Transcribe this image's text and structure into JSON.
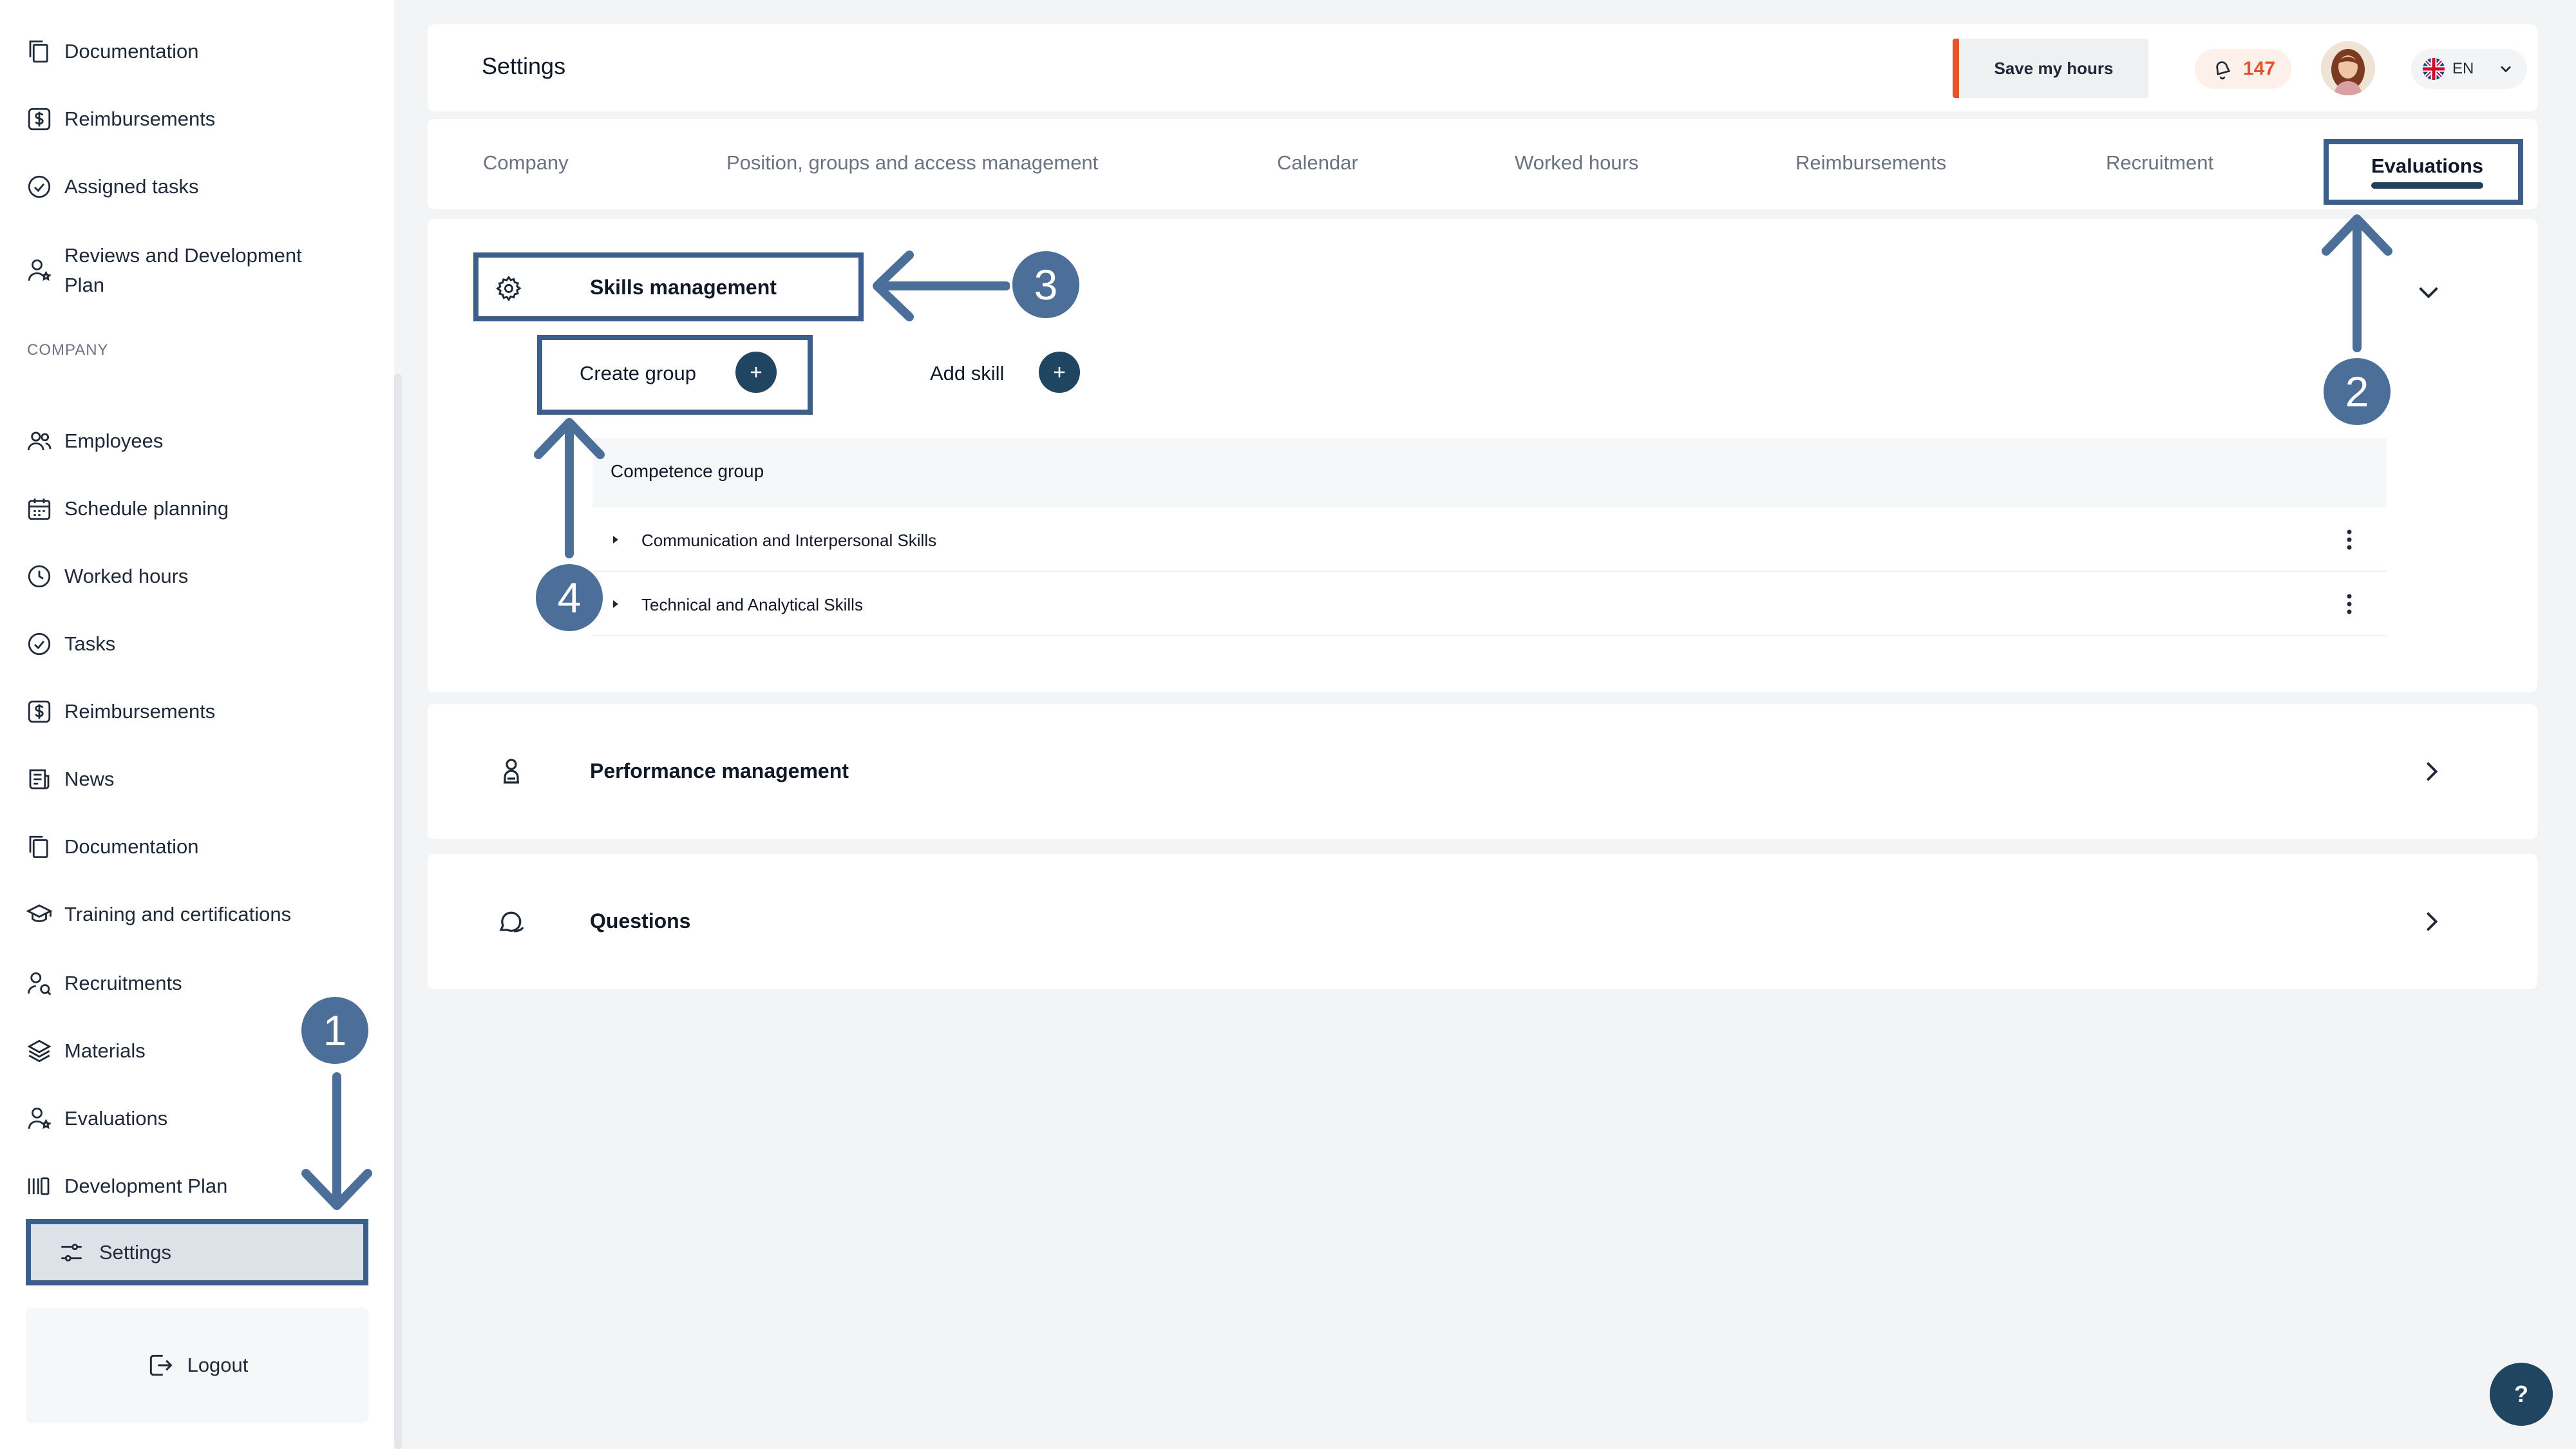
{
  "sidebar": {
    "items_top": [
      {
        "label": "Documentation",
        "icon": "documents-icon"
      },
      {
        "label": "Reimbursements",
        "icon": "dollar-icon"
      },
      {
        "label": "Assigned tasks",
        "icon": "check-circle-icon"
      },
      {
        "label": "Reviews and Development Plan",
        "icon": "user-star-icon"
      }
    ],
    "section_title": "COMPANY",
    "items_company": [
      {
        "label": "Employees",
        "icon": "users-icon"
      },
      {
        "label": "Schedule planning",
        "icon": "calendar-icon"
      },
      {
        "label": "Worked hours",
        "icon": "clock-icon"
      },
      {
        "label": "Tasks",
        "icon": "check-circle-icon"
      },
      {
        "label": "Reimbursements",
        "icon": "dollar-icon"
      },
      {
        "label": "News",
        "icon": "news-icon"
      },
      {
        "label": "Documentation",
        "icon": "documents-icon"
      },
      {
        "label": "Training and certifications",
        "icon": "graduation-cap-icon"
      },
      {
        "label": "Recruitments",
        "icon": "user-search-icon"
      },
      {
        "label": "Materials",
        "icon": "layers-icon"
      },
      {
        "label": "Evaluations",
        "icon": "user-star-icon"
      },
      {
        "label": "Development Plan",
        "icon": "chart-bars-icon"
      }
    ],
    "settings": "Settings",
    "logout": "Logout"
  },
  "header": {
    "title": "Settings",
    "save_hours": "Save my hours",
    "notifications": "147",
    "language": "EN"
  },
  "tabs": [
    {
      "label": "Company"
    },
    {
      "label": "Position, groups and access management"
    },
    {
      "label": "Calendar"
    },
    {
      "label": "Worked hours"
    },
    {
      "label": "Reimbursements"
    },
    {
      "label": "Recruitment"
    },
    {
      "label": "Evaluations"
    }
  ],
  "skills": {
    "title": "Skills management",
    "create_group": "Create group",
    "add_skill": "Add skill",
    "table_header": "Competence group",
    "rows": [
      {
        "label": "Communication and Interpersonal Skills"
      },
      {
        "label": "Technical and Analytical Skills"
      }
    ]
  },
  "sections": [
    {
      "label": "Performance management"
    },
    {
      "label": "Questions"
    }
  ],
  "help": "?",
  "annotations": [
    "1",
    "2",
    "3",
    "4"
  ],
  "colors": {
    "accent": "#1f4560",
    "annotation": "#4b6f99",
    "annotation_border": "#3b5f8a",
    "warning": "#e5532d"
  }
}
